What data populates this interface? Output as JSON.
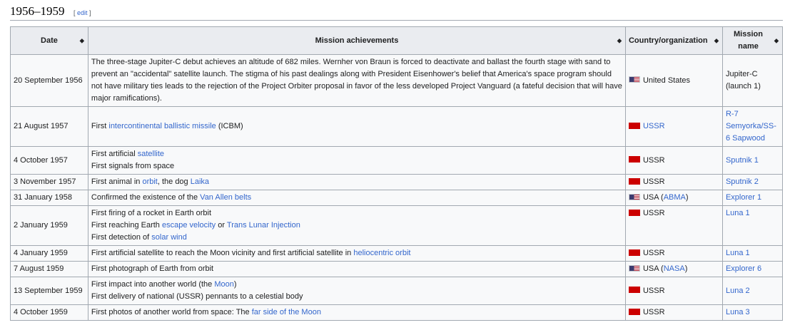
{
  "section": {
    "title": "1956–1959",
    "edit_open": "[",
    "edit_label": "edit",
    "edit_close": "]"
  },
  "headers": {
    "date": "Date",
    "mission": "Mission achievements",
    "country": "Country/organization",
    "name": "Mission name"
  },
  "sort_icon": "sort-arrows-icon",
  "rows": [
    {
      "date": "20 September 1956",
      "lines": [
        [
          {
            "t": "The three-stage Jupiter-C debut achieves an altitude of 682 miles. Wernher von Braun is forced to deactivate and ballast the fourth stage with sand to prevent an \"accidental\" satellite launch. The stigma of his past dealings along with President Eisenhower's belief that America's space program should not have military ties leads to the rejection of the Project Orbiter proposal in favor of the less developed Project Vanguard (a fateful decision that will have major ramifications)."
          }
        ]
      ],
      "flag": "us",
      "country": [
        {
          "t": "United States"
        }
      ],
      "name": "Jupiter-C (launch 1)",
      "name_link": false
    },
    {
      "date": "21 August 1957",
      "lines": [
        [
          {
            "t": "First "
          },
          {
            "t": "intercontinental ballistic missile",
            "link": true
          },
          {
            "t": " (ICBM)"
          }
        ]
      ],
      "flag": "ussr",
      "country": [
        {
          "t": "USSR",
          "link": true
        }
      ],
      "name": "R-7 Semyorka/SS-6 Sapwood",
      "name_link": true
    },
    {
      "date": "4 October 1957",
      "lines": [
        [
          {
            "t": "First artificial "
          },
          {
            "t": "satellite",
            "link": true
          }
        ],
        [
          {
            "t": "First signals from space"
          }
        ]
      ],
      "flag": "ussr",
      "country": [
        {
          "t": "USSR"
        }
      ],
      "name": "Sputnik 1",
      "name_link": true
    },
    {
      "date": "3 November 1957",
      "lines": [
        [
          {
            "t": "First animal in "
          },
          {
            "t": "orbit",
            "link": true
          },
          {
            "t": ", the dog "
          },
          {
            "t": "Laika",
            "link": true
          }
        ]
      ],
      "flag": "ussr",
      "country": [
        {
          "t": "USSR"
        }
      ],
      "name": "Sputnik 2",
      "name_link": true
    },
    {
      "date": "31 January 1958",
      "lines": [
        [
          {
            "t": "Confirmed the existence of the "
          },
          {
            "t": "Van Allen belts",
            "link": true
          }
        ]
      ],
      "flag": "us",
      "country": [
        {
          "t": "USA ("
        },
        {
          "t": "ABMA",
          "link": true
        },
        {
          "t": ")"
        }
      ],
      "name": "Explorer 1",
      "name_link": true
    },
    {
      "date": "2 January 1959",
      "lines": [
        [
          {
            "t": "First firing of a rocket in Earth orbit"
          }
        ],
        [
          {
            "t": "First reaching Earth "
          },
          {
            "t": "escape velocity",
            "link": true
          },
          {
            "t": " or "
          },
          {
            "t": "Trans Lunar Injection",
            "link": true
          }
        ],
        [
          {
            "t": "First detection of "
          },
          {
            "t": "solar wind",
            "link": true
          }
        ]
      ],
      "flag": "ussr",
      "country": [
        {
          "t": "USSR"
        }
      ],
      "name": "Luna 1",
      "name_link": true,
      "top": true
    },
    {
      "date": "4 January 1959",
      "lines": [
        [
          {
            "t": "First artificial satellite to reach the Moon vicinity and first artificial satellite in "
          },
          {
            "t": "heliocentric orbit",
            "link": true
          }
        ]
      ],
      "flag": "ussr",
      "country": [
        {
          "t": "USSR"
        }
      ],
      "name": "Luna 1",
      "name_link": true
    },
    {
      "date": "7 August 1959",
      "lines": [
        [
          {
            "t": "First photograph of Earth from orbit"
          }
        ]
      ],
      "flag": "us",
      "country": [
        {
          "t": "USA ("
        },
        {
          "t": "NASA",
          "link": true
        },
        {
          "t": ")"
        }
      ],
      "name": "Explorer 6",
      "name_link": true
    },
    {
      "date": "13 September 1959",
      "lines": [
        [
          {
            "t": "First impact into another world (the "
          },
          {
            "t": "Moon",
            "link": true
          },
          {
            "t": ")"
          }
        ],
        [
          {
            "t": "First delivery of national (USSR) pennants to a celestial body"
          }
        ]
      ],
      "flag": "ussr",
      "country": [
        {
          "t": "USSR"
        }
      ],
      "name": "Luna 2",
      "name_link": true
    },
    {
      "date": "4 October 1959",
      "lines": [
        [
          {
            "t": "First photos of another world from space: The "
          },
          {
            "t": "far side of the Moon",
            "link": true
          }
        ]
      ],
      "flag": "ussr",
      "country": [
        {
          "t": "USSR"
        }
      ],
      "name": "Luna 3",
      "name_link": true
    }
  ]
}
